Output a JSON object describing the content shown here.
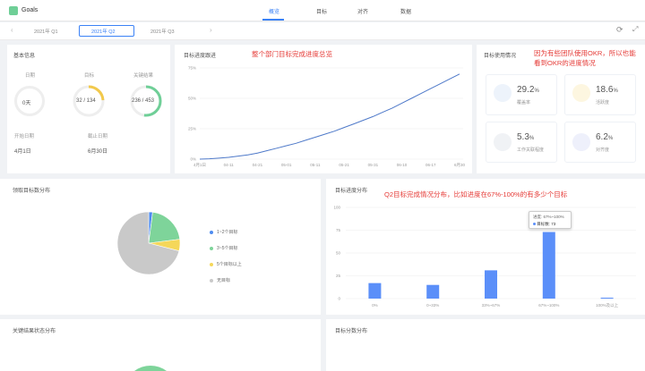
{
  "app": {
    "title": "Goals"
  },
  "nav": {
    "tabs": [
      "概览",
      "目标",
      "对齐",
      "数据"
    ],
    "active": 0
  },
  "periods": {
    "prev": "2021年 Q1",
    "current": "2021年 Q2",
    "next": "2021年 Q3"
  },
  "basic_info": {
    "title": "基本信息",
    "days_label": "日期",
    "days_value": "0天",
    "goals_label": "目标",
    "goals_value": "32 / 134",
    "goals_progress": 0.24,
    "kr_label": "关键结果",
    "kr_value": "236 / 453",
    "kr_progress": 0.52,
    "start_label": "开始日期",
    "start_value": "4月1日",
    "end_label": "截止日期",
    "end_value": "6月30日"
  },
  "progress_chart": {
    "title": "目标进度跟进",
    "note": "整个部门目标完成进度总览"
  },
  "usage": {
    "title": "目标使用情况",
    "note": "因为有些团队使用OKR，所以也能看到OKR的进度情况",
    "items": [
      {
        "value": "29.2",
        "unit": "%",
        "label": "覆盖率",
        "icon": "chart-icon"
      },
      {
        "value": "18.6",
        "unit": "%",
        "label": "活跃度",
        "icon": "sun-icon"
      },
      {
        "value": "5.3",
        "unit": "%",
        "label": "工作关联程度",
        "icon": "link-icon"
      },
      {
        "value": "6.2",
        "unit": "%",
        "label": "对齐度",
        "icon": "bulb-icon"
      }
    ]
  },
  "kr_pie": {
    "title": "领取目标数分布",
    "legend": [
      "1~2个目标",
      "3~5个目标",
      "5个目标以上",
      "无目标"
    ],
    "colors": [
      "#4e8cf0",
      "#7ed49a",
      "#f5d75a",
      "#c9c9c9"
    ]
  },
  "dist_chart": {
    "title": "目标进度分布",
    "note": "Q2目标完成情况分布，比如进度在67%-100%的有多少个目标",
    "tooltip_title": "进度: 67%~100%",
    "tooltip_label": "目标数:",
    "tooltip_value": "73"
  },
  "bottom_left": {
    "title": "关键结果状态分布"
  },
  "bottom_right": {
    "title": "目标分数分布"
  },
  "chart_data": [
    {
      "type": "line",
      "title": "目标进度跟进",
      "x_ticks": [
        "4月1日",
        "04-11",
        "04-21",
        "05-01",
        "05-11",
        "05-21",
        "05-31",
        "06-10",
        "06-17",
        "6月30"
      ],
      "y_ticks": [
        "0%",
        "25%",
        "50%",
        "75%"
      ],
      "ylim": [
        0,
        75
      ],
      "series": [
        {
          "values": [
            0,
            0.3,
            0.8,
            1.5,
            2.5,
            3.5,
            5,
            7,
            9,
            11,
            13,
            15.5,
            18,
            20.5,
            23,
            26,
            29,
            32,
            35,
            38.5,
            42,
            46,
            50,
            54,
            58,
            62,
            66,
            70
          ]
        }
      ]
    },
    {
      "type": "pie",
      "title": "领取目标数分布",
      "categories": [
        "1~2个目标",
        "3~5个目标",
        "5个目标以上",
        "无目标"
      ],
      "values": [
        2,
        21,
        6,
        71
      ]
    },
    {
      "type": "bar",
      "title": "目标进度分布",
      "categories": [
        "0%",
        "0~33%",
        "33%~67%",
        "67%~100%",
        "100%及以上"
      ],
      "values": [
        17,
        15,
        31,
        73,
        1
      ],
      "y_ticks": [
        "0",
        "25",
        "50",
        "75",
        "100"
      ],
      "ylim": [
        0,
        100
      ]
    }
  ]
}
